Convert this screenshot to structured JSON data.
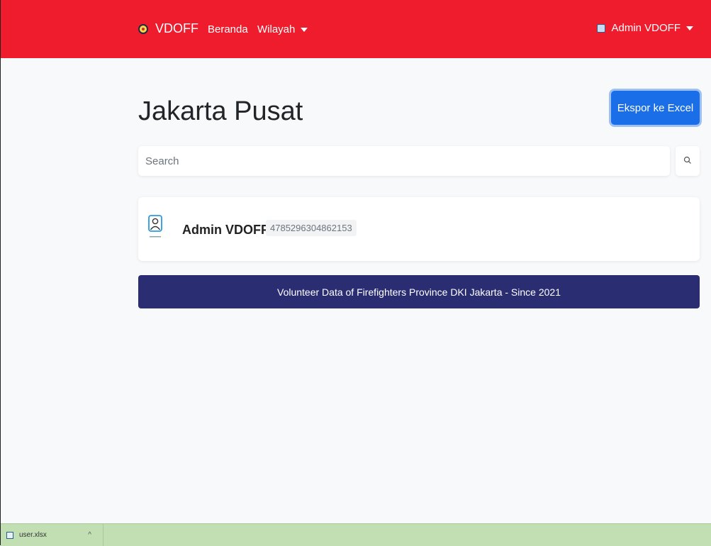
{
  "navbar": {
    "brand": "VDOFF",
    "links": [
      "Beranda",
      "Wilayah"
    ],
    "user": "Admin VDOFF",
    "color": "#ee1c2c"
  },
  "page": {
    "title": "Jakarta Pusat",
    "export_label": "Ekspor ke Excel"
  },
  "search": {
    "placeholder": "Search",
    "icon": "search-icon"
  },
  "results": [
    {
      "name": "Admin VDOFF",
      "id": "4785296304862153",
      "icon": "person-avatar-icon"
    }
  ],
  "footer": {
    "text": "Volunteer Data of Firefighters Province DKI Jakarta - Since 2021",
    "color": "#2b2d72"
  },
  "downloads": {
    "file": "user.xlsx"
  }
}
